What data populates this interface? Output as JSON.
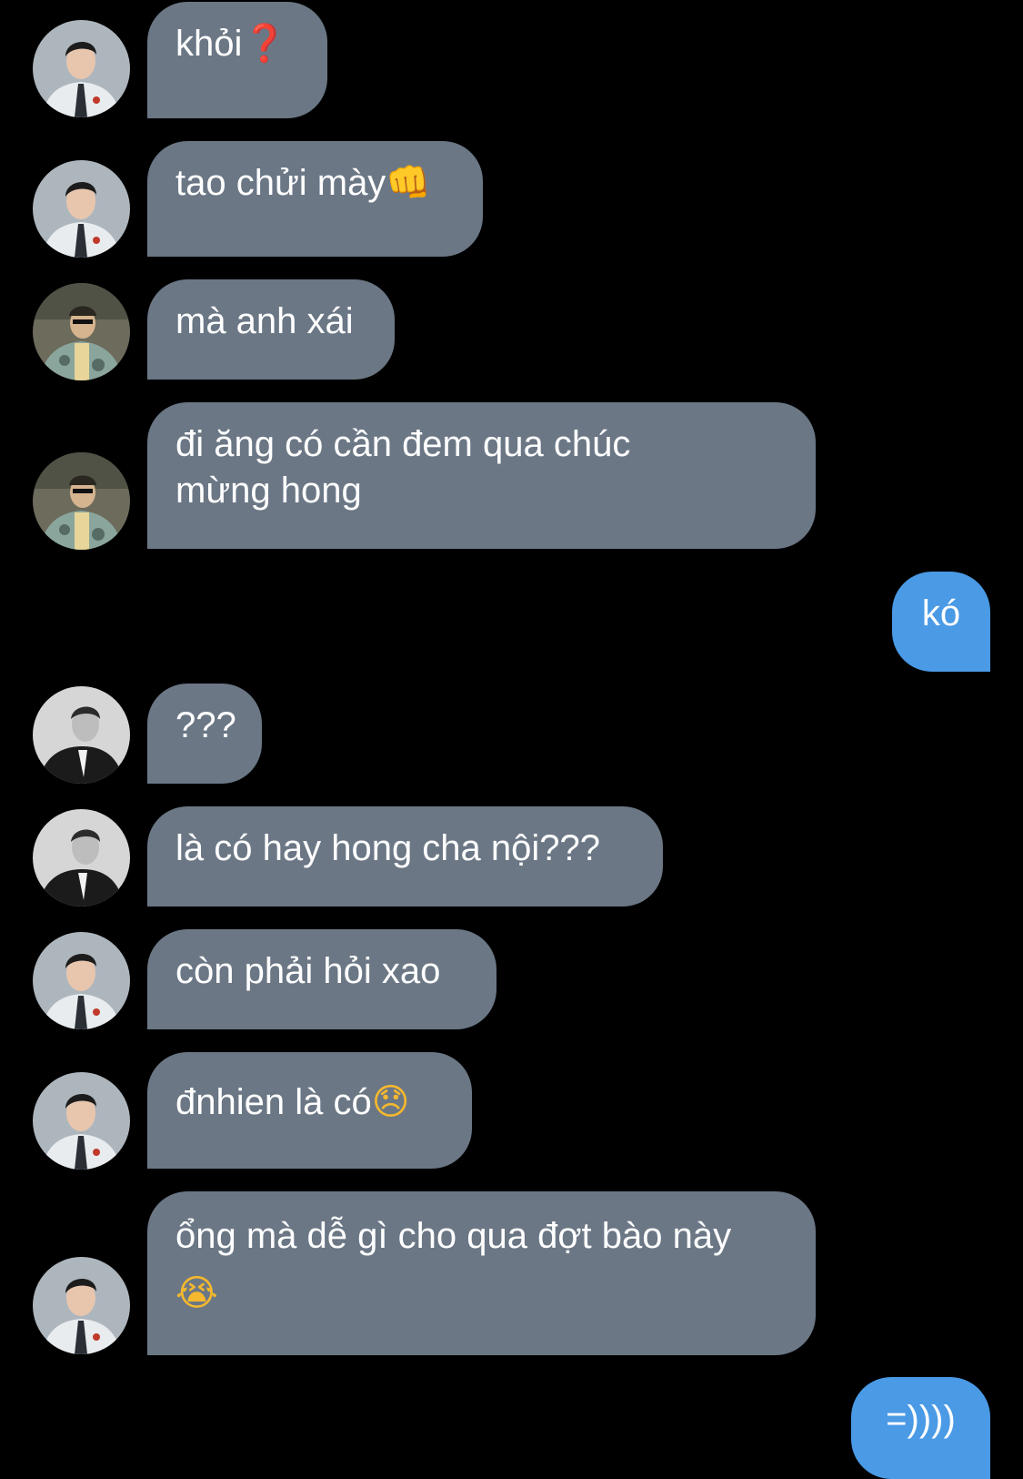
{
  "colors": {
    "background": "#000000",
    "incoming_bubble": "#6b7785",
    "outgoing_bubble": "#4a9ae6",
    "text": "#ffffff"
  },
  "messages": [
    {
      "sender": "incoming",
      "avatar": "avatar-a",
      "text": "khỏi",
      "emoji": "❓",
      "emoji_color": "#d33a2c"
    },
    {
      "sender": "incoming",
      "avatar": "avatar-a",
      "text": "tao chửi mày",
      "emoji": "👊",
      "emoji_color": "#f3c8a0"
    },
    {
      "sender": "incoming",
      "avatar": "avatar-b",
      "text": "mà anh xái"
    },
    {
      "sender": "incoming",
      "avatar": "avatar-b",
      "text": "đi ăng có cần đem qua chúc mừng hong"
    },
    {
      "sender": "outgoing",
      "text": "kó"
    },
    {
      "sender": "incoming",
      "avatar": "avatar-c",
      "text": "???"
    },
    {
      "sender": "incoming",
      "avatar": "avatar-c",
      "text": "là có hay hong cha nội???"
    },
    {
      "sender": "incoming",
      "avatar": "avatar-a",
      "text": "còn phải hỏi xao"
    },
    {
      "sender": "incoming",
      "avatar": "avatar-a",
      "text": "đnhien là có",
      "emoji": "😞",
      "emoji_color": "#f5b82e"
    },
    {
      "sender": "incoming",
      "avatar": "avatar-a",
      "text": "ổng mà dễ gì cho qua đợt bào này",
      "emoji": "😭",
      "emoji_color": "#f5b82e"
    },
    {
      "sender": "outgoing",
      "text": "=))))"
    }
  ]
}
